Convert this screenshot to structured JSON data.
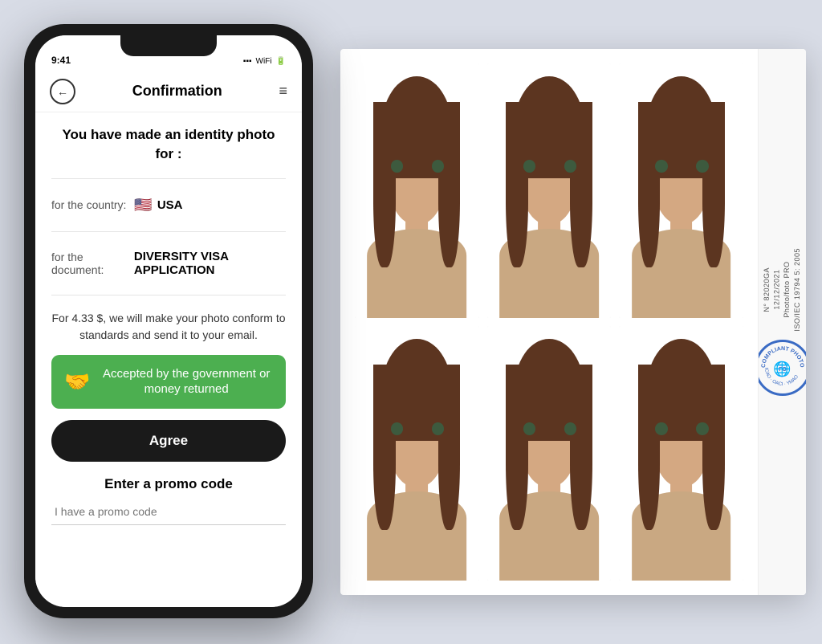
{
  "page": {
    "background_color": "#d8dce6"
  },
  "phone": {
    "status_time": "9:41",
    "nav": {
      "back_icon": "←",
      "title": "Confirmation",
      "menu_icon": "≡"
    },
    "content": {
      "heading": "You have made an identity photo for :",
      "country_label": "for the country:",
      "country_flag": "🇺🇸",
      "country_value": "USA",
      "document_label": "for the document:",
      "document_value": "DIVERSITY VISA APPLICATION",
      "price_text": "For 4.33 $, we will make your photo conform to standards and send it to your email.",
      "guarantee_icon": "🤝",
      "guarantee_text": "Accepted by the government or money returned",
      "agree_button": "Agree",
      "promo_section_title": "Enter a promo code",
      "promo_placeholder": "I have a promo code"
    }
  },
  "photo_sheet": {
    "sidebar": {
      "number": "N° 82020GA",
      "date": "12/12/2021",
      "brand": "Photo/foto PRO",
      "standard": "ISO/IEC 19794 5: 2005"
    },
    "stamp": {
      "text": "COMPLIANT PHOTOS",
      "inner": "ICAO\nFO"
    }
  }
}
